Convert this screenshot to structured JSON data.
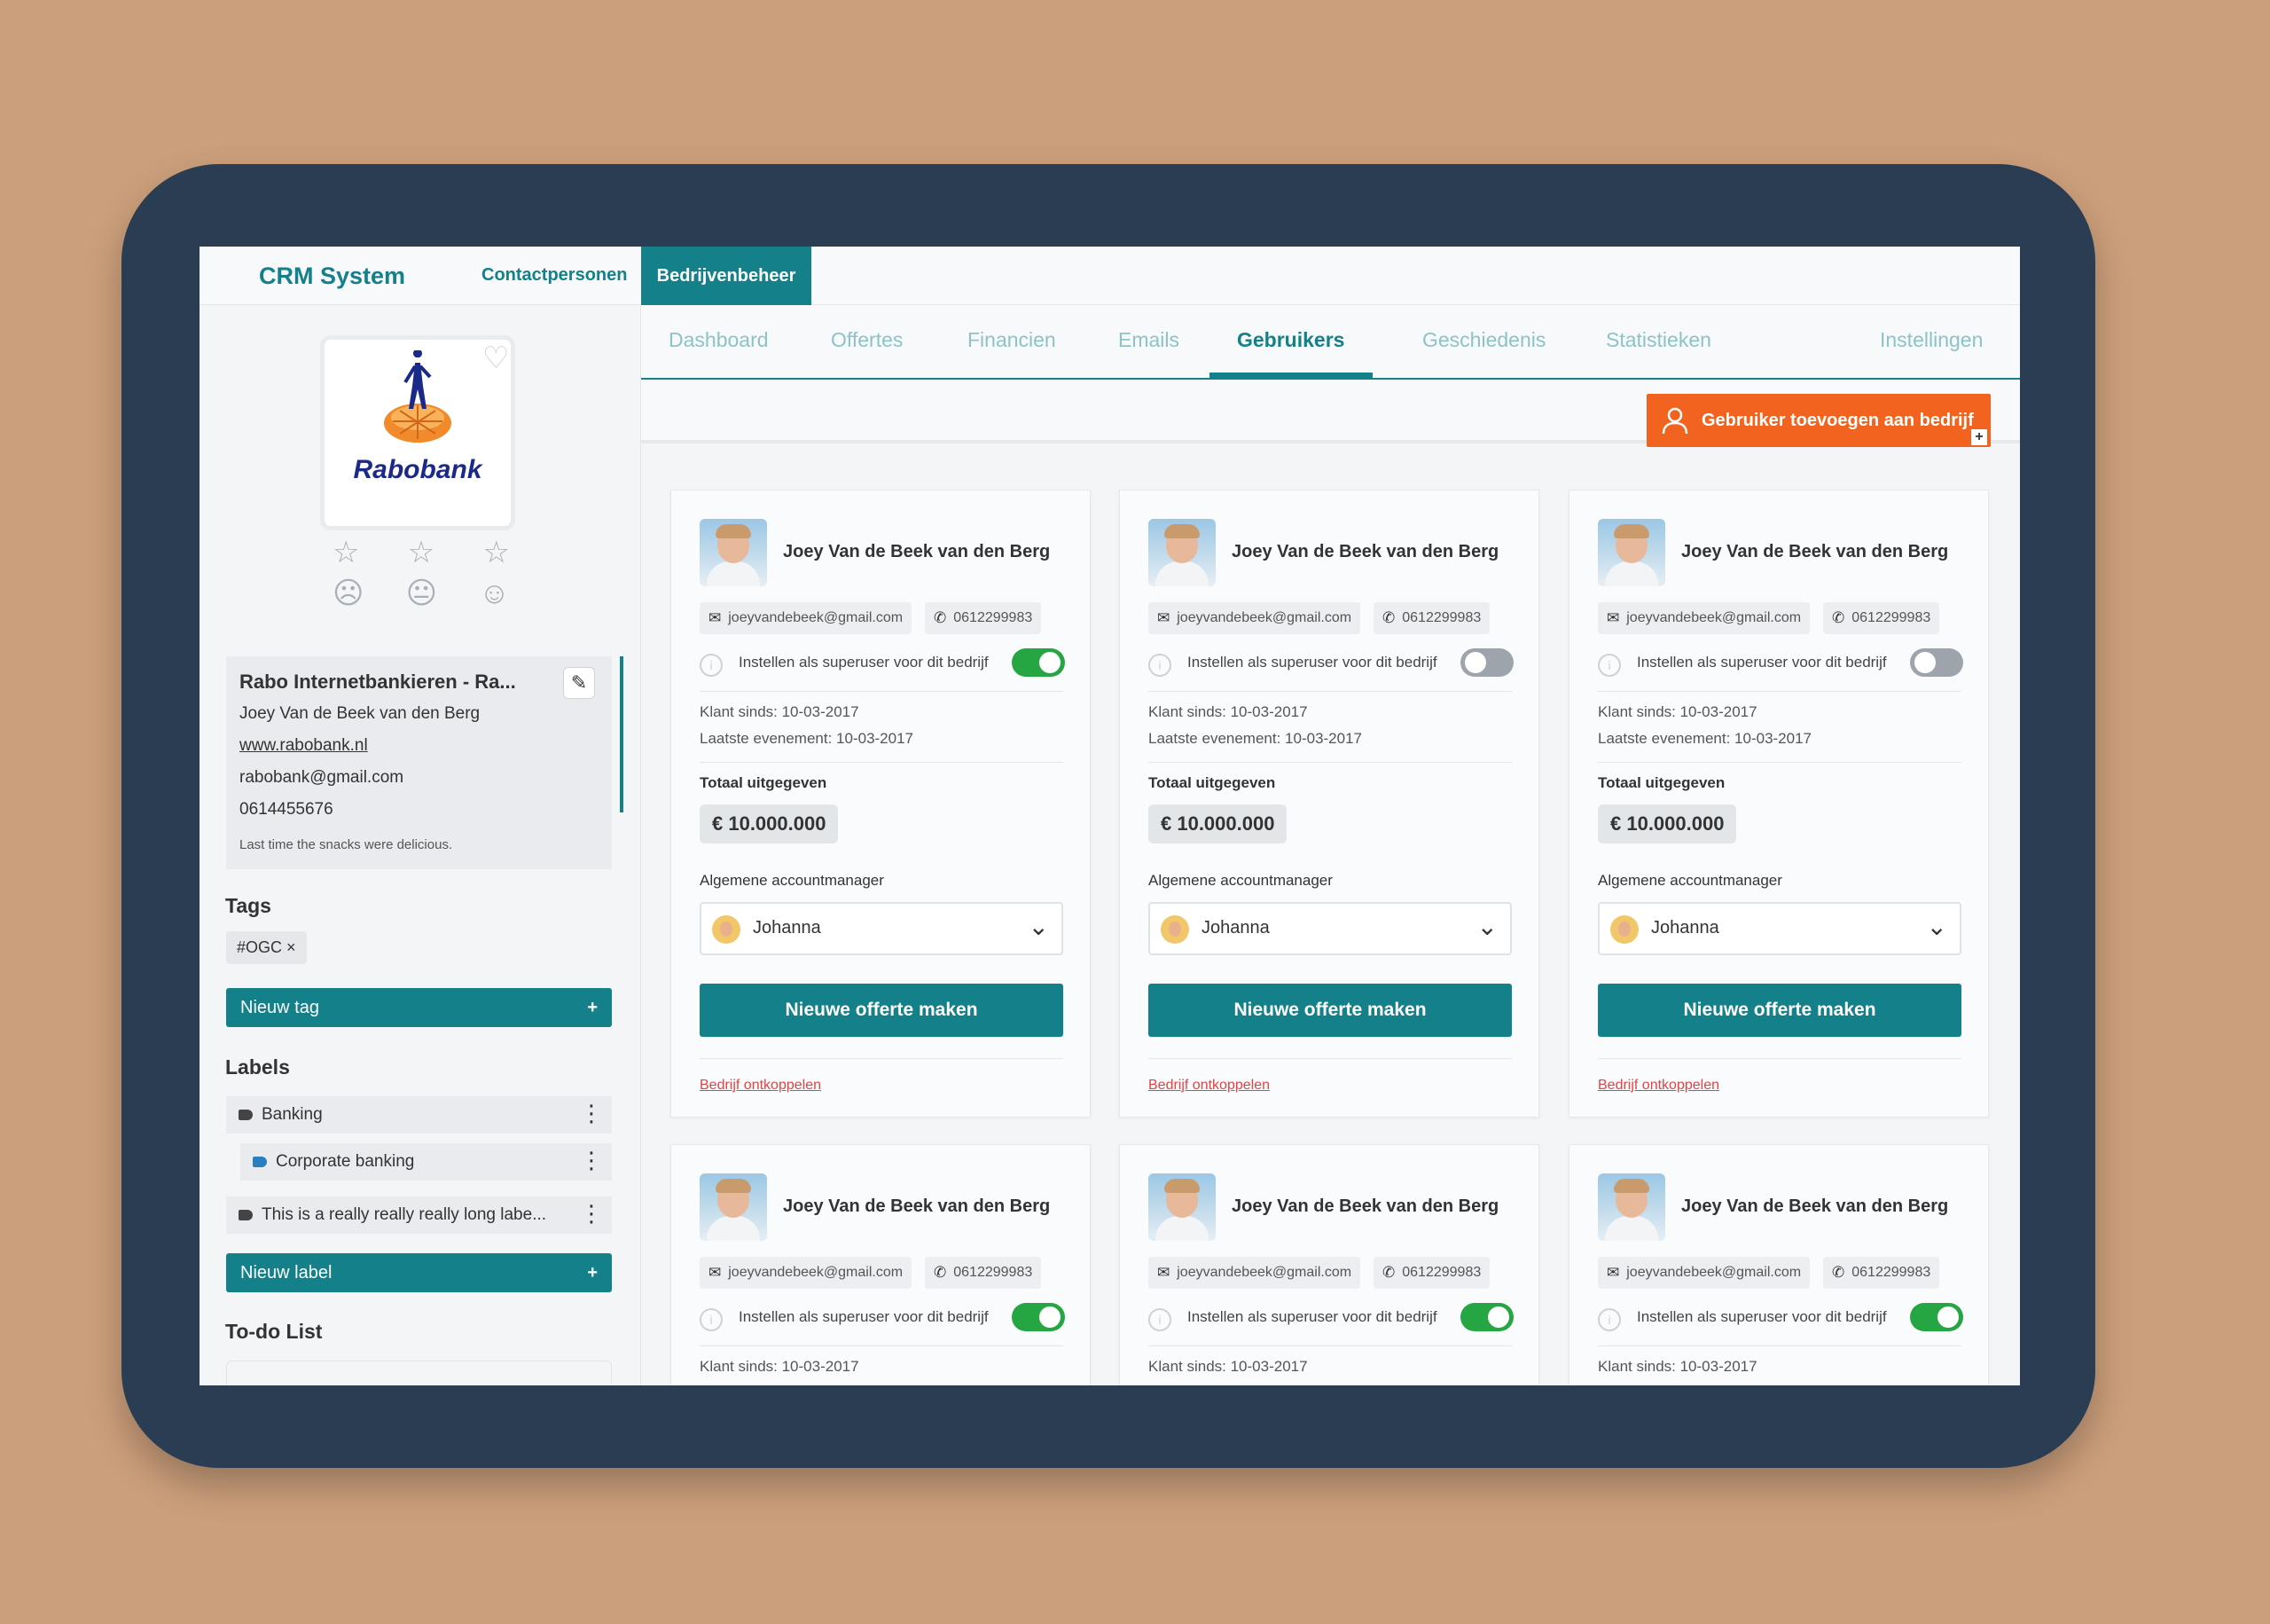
{
  "app": {
    "brand": "CRM System"
  },
  "topnav": {
    "contacts": "Contactpersonen",
    "companies": "Bedrijvenbeheer"
  },
  "sidebar": {
    "logo_text": "Rabobank",
    "info": {
      "title": "Rabo Internetbankieren - Ra...",
      "contact": "Joey Van de Beek van den Berg",
      "website": "www.rabobank.nl",
      "email": "rabobank@gmail.com",
      "phone": "0614455676",
      "note": "Last time the snacks were delicious."
    },
    "tags_heading": "Tags",
    "tags": [
      "#OGC ×"
    ],
    "new_tag": "Nieuw tag",
    "labels_heading": "Labels",
    "labels": [
      "Banking",
      "Corporate banking",
      "This is a really really really long labe..."
    ],
    "new_label": "Nieuw label",
    "todo_heading": "To-do List",
    "plus": "+"
  },
  "tabs": [
    "Dashboard",
    "Offertes",
    "Financien",
    "Emails",
    "Gebruikers",
    "Geschiedenis",
    "Statistieken",
    "Instellingen"
  ],
  "active_tab": "Gebruikers",
  "actions": {
    "add_user": "Gebruiker toevoegen aan bedrijf"
  },
  "cards": [
    {
      "name": "Joey Van de Beek van den Berg",
      "email": "joeyvandebeek@gmail.com",
      "phone": "0612299983",
      "superuser_label": "Instellen als superuser voor dit bedrijf",
      "superuser": true,
      "client_since": "Klant sinds: 10-03-2017",
      "last_event": "Laatste evenement: 10-03-2017",
      "total_label": "Totaal uitgegeven",
      "total": "€ 10.000.000",
      "manager_label": "Algemene accountmanager",
      "manager": "Johanna",
      "offer_button": "Nieuwe offerte maken",
      "unlink": "Bedrijf ontkoppelen"
    },
    {
      "name": "Joey Van de Beek van den Berg",
      "email": "joeyvandebeek@gmail.com",
      "phone": "0612299983",
      "superuser_label": "Instellen als superuser voor dit bedrijf",
      "superuser": false,
      "client_since": "Klant sinds: 10-03-2017",
      "last_event": "Laatste evenement: 10-03-2017",
      "total_label": "Totaal uitgegeven",
      "total": "€ 10.000.000",
      "manager_label": "Algemene accountmanager",
      "manager": "Johanna",
      "offer_button": "Nieuwe offerte maken",
      "unlink": "Bedrijf ontkoppelen"
    },
    {
      "name": "Joey Van de Beek van den Berg",
      "email": "joeyvandebeek@gmail.com",
      "phone": "0612299983",
      "superuser_label": "Instellen als superuser voor dit bedrijf",
      "superuser": false,
      "client_since": "Klant sinds: 10-03-2017",
      "last_event": "Laatste evenement: 10-03-2017",
      "total_label": "Totaal uitgegeven",
      "total": "€ 10.000.000",
      "manager_label": "Algemene accountmanager",
      "manager": "Johanna",
      "offer_button": "Nieuwe offerte maken",
      "unlink": "Bedrijf ontkoppelen"
    },
    {
      "name": "Joey Van de Beek van den Berg",
      "email": "joeyvandebeek@gmail.com",
      "phone": "0612299983",
      "superuser_label": "Instellen als superuser voor dit bedrijf",
      "superuser": true,
      "client_since": "Klant sinds: 10-03-2017"
    },
    {
      "name": "Joey Van de Beek van den Berg",
      "email": "joeyvandebeek@gmail.com",
      "phone": "0612299983",
      "superuser_label": "Instellen als superuser voor dit bedrijf",
      "superuser": true,
      "client_since": "Klant sinds: 10-03-2017"
    },
    {
      "name": "Joey Van de Beek van den Berg",
      "email": "joeyvandebeek@gmail.com",
      "phone": "0612299983",
      "superuser_label": "Instellen als superuser voor dit bedrijf",
      "superuser": true,
      "client_since": "Klant sinds: 10-03-2017"
    }
  ],
  "colors": {
    "teal": "#13808a",
    "orange": "#f1631e",
    "toggle_on": "#25a642",
    "toggle_off": "#9ea4ab",
    "danger": "#e04545"
  }
}
